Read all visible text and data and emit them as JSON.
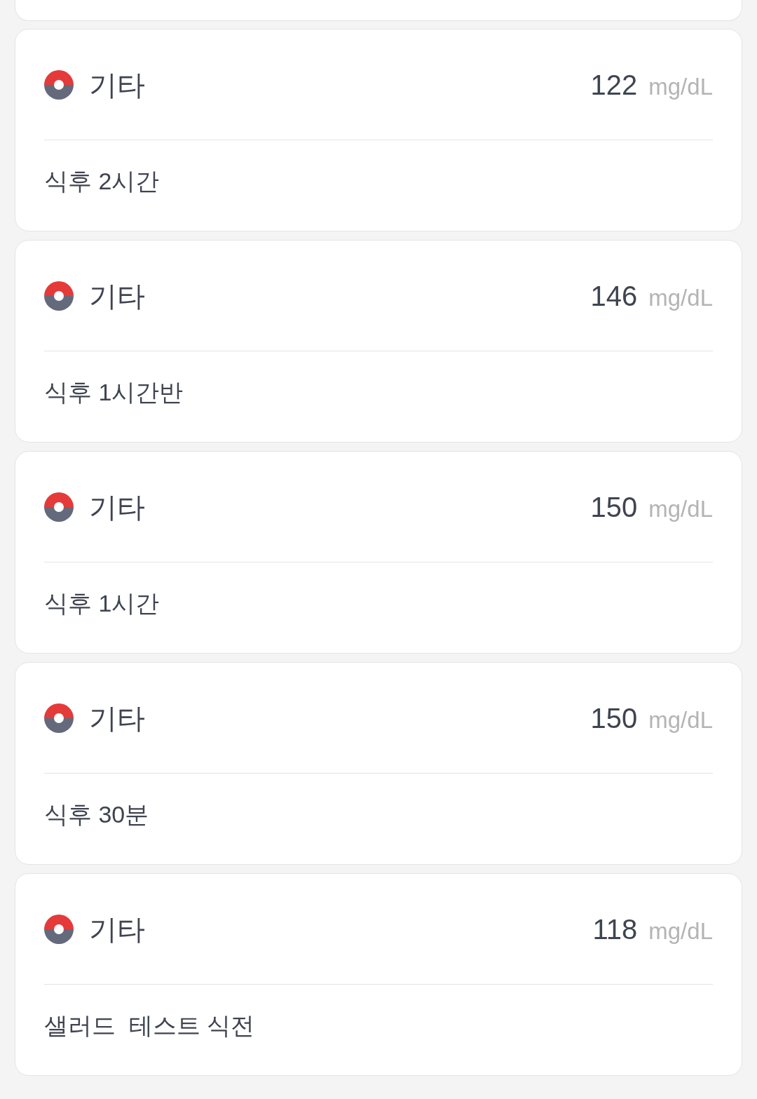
{
  "entries": [
    {
      "category": "기타",
      "value": "122",
      "unit": "mg/dL",
      "note": "식후 2시간"
    },
    {
      "category": "기타",
      "value": "146",
      "unit": "mg/dL",
      "note": "식후 1시간반"
    },
    {
      "category": "기타",
      "value": "150",
      "unit": "mg/dL",
      "note": "식후 1시간"
    },
    {
      "category": "기타",
      "value": "150",
      "unit": "mg/dL",
      "note": "식후 30분"
    },
    {
      "category": "기타",
      "value": "118",
      "unit": "mg/dL",
      "note": "샐러드  테스트 식전"
    }
  ]
}
